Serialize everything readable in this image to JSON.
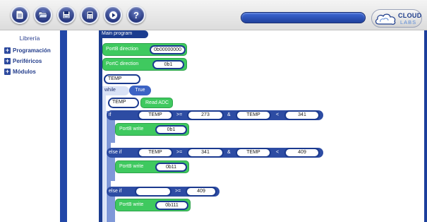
{
  "toolbar": {
    "buttons": [
      {
        "name": "new-file-button",
        "icon": "document-icon"
      },
      {
        "name": "open-folder-button",
        "icon": "folder-icon"
      },
      {
        "name": "save-button",
        "icon": "floppy-icon"
      },
      {
        "name": "calculator-button",
        "icon": "calculator-icon"
      },
      {
        "name": "run-button",
        "icon": "play-icon"
      },
      {
        "name": "help-button",
        "icon": "help-icon",
        "label": "?"
      }
    ],
    "logo": {
      "line1": "CLOUD",
      "line2": "LABS"
    }
  },
  "sidebar": {
    "title": "Librería",
    "items": [
      {
        "label": "Programación"
      },
      {
        "label": "Periféricos"
      },
      {
        "label": "Módulos"
      }
    ]
  },
  "program": {
    "main_label": "Main program",
    "portb_direction": {
      "label": "PortB direction",
      "value": "0b00000000"
    },
    "portc_direction": {
      "label": "PortC direction",
      "value": "0b1"
    },
    "variable": "TEMP",
    "while": {
      "label": "while",
      "condition": "True"
    },
    "read_adc": {
      "variable": "TEMP",
      "label": "Read ADC"
    },
    "if_block": {
      "label": "if",
      "left_var": "TEMP",
      "op1": ">=",
      "value1": "273",
      "connector": "&",
      "right_var": "TEMP",
      "op2": "<",
      "value2": "341",
      "write_label": "PortB write",
      "write_value": "0b1"
    },
    "else_if_1": {
      "label": "else if",
      "left_var": "TEMP",
      "op1": ">=",
      "value1": "341",
      "connector": "&",
      "right_var": "TEMP",
      "op2": "<",
      "value2": "409",
      "write_label": "PortB write",
      "write_value": "0b11"
    },
    "else_if_2": {
      "label": "else if",
      "left_var": "",
      "op1": ">=",
      "value1": "409",
      "write_label": "PortB write",
      "write_value": "0b111"
    }
  },
  "colors": {
    "accent": "#1b3c8f",
    "block_green": "#3fc95f",
    "sidebar_scroll": "#2247a8"
  }
}
